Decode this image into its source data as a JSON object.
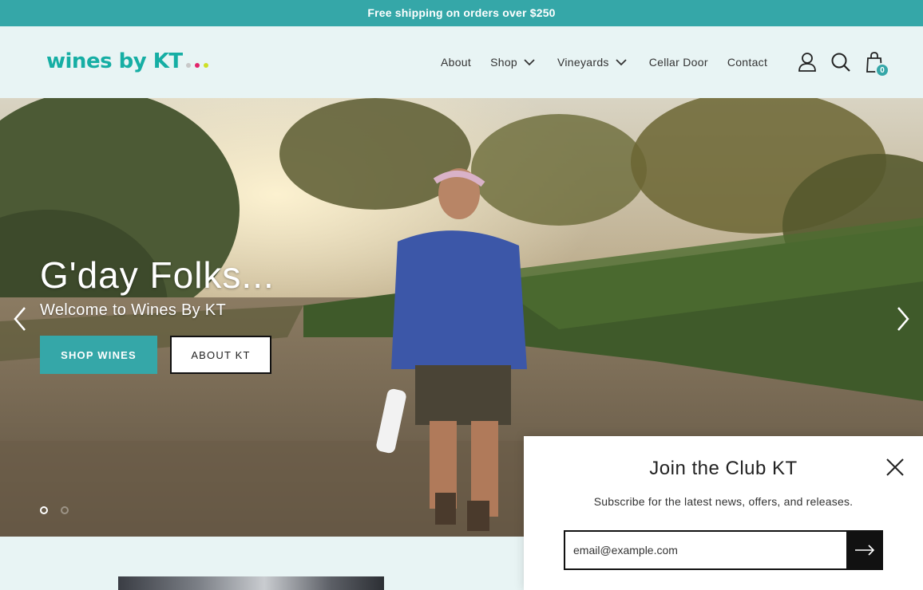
{
  "announcement": "Free shipping on orders over $250",
  "logo": {
    "text": "wines by KT",
    "dot_colors": [
      "#c8c8c8",
      "#e2246b",
      "#cde026"
    ]
  },
  "nav": {
    "items": [
      {
        "label": "About",
        "has_dropdown": false
      },
      {
        "label": "Shop",
        "has_dropdown": true
      },
      {
        "label": "Vineyards",
        "has_dropdown": true
      },
      {
        "label": "Cellar Door",
        "has_dropdown": false
      },
      {
        "label": "Contact",
        "has_dropdown": false
      }
    ],
    "icons": [
      "account-icon",
      "search-icon",
      "cart-icon"
    ],
    "cart_count": "0"
  },
  "hero": {
    "title": "G'day Folks...",
    "subtitle": "Welcome to Wines By KT",
    "primary_button": "SHOP WINES",
    "secondary_button": "ABOUT KT",
    "slide_count": 2,
    "active_slide": 1
  },
  "popup": {
    "title": "Join the Club KT",
    "subtitle": "Subscribe for the latest news, offers, and releases.",
    "email_placeholder": "email@example.com"
  },
  "colors": {
    "accent": "#35a7a8",
    "logo": "#16aea4",
    "header_bg": "#e8f4f4"
  }
}
